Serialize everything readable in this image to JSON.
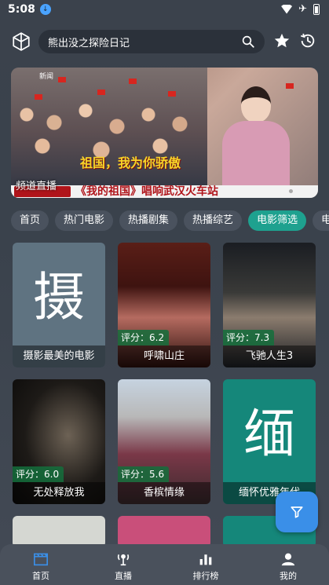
{
  "status": {
    "time": "5:08"
  },
  "search": {
    "value": "熊出没之探险日记"
  },
  "banner": {
    "caption": "祖国，我为你骄傲",
    "news_ticker": "《我的祖国》唱响武汉火车站",
    "channel_label": "频道直播",
    "top_tag": "新闻"
  },
  "tabs": [
    {
      "label": "首页",
      "active": false
    },
    {
      "label": "热门电影",
      "active": false
    },
    {
      "label": "热播剧集",
      "active": false
    },
    {
      "label": "热播综艺",
      "active": false
    },
    {
      "label": "电影筛选",
      "active": true
    },
    {
      "label": "电视",
      "active": false
    }
  ],
  "cards": [
    {
      "title": "摄影最美的电影",
      "big_char": "摄",
      "rating": ""
    },
    {
      "title": "呼啸山庄",
      "big_char": "",
      "rating": "评分：6.2"
    },
    {
      "title": "飞驰人生3",
      "big_char": "",
      "rating": "评分：7.3"
    },
    {
      "title": "无处释放我",
      "big_char": "",
      "rating": "评分：6.0"
    },
    {
      "title": "香槟情缘",
      "big_char": "",
      "rating": "评分：5.6"
    },
    {
      "title": "缅怀优雅年代",
      "big_char": "缅",
      "rating": ""
    }
  ],
  "nav": [
    {
      "label": "首页",
      "icon": "clapperboard-icon",
      "active": true
    },
    {
      "label": "直播",
      "icon": "live-icon",
      "active": false
    },
    {
      "label": "排行榜",
      "icon": "bar-chart-icon",
      "active": false
    },
    {
      "label": "我的",
      "icon": "user-icon",
      "active": false
    }
  ],
  "colors": {
    "accent": "#1ea18f",
    "fab": "#3a8fe8",
    "nav_active": "#3a8fe8",
    "card_teal": "#15877a",
    "card_slate": "#5f7381"
  }
}
